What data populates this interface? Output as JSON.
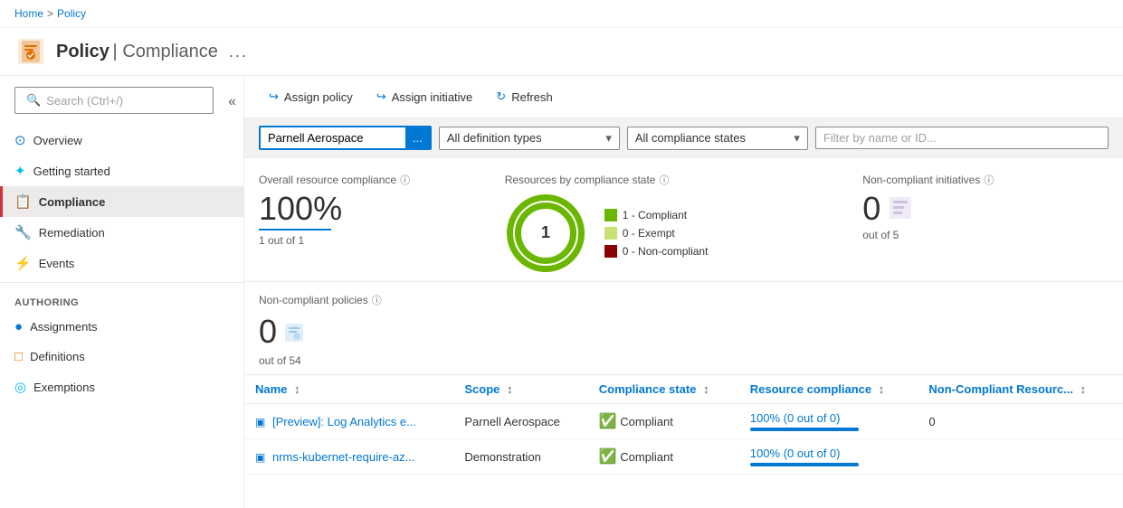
{
  "breadcrumb": {
    "home": "Home",
    "separator": ">",
    "current": "Policy"
  },
  "header": {
    "title": "Policy",
    "subtitle": "Compliance",
    "ellipsis": "..."
  },
  "sidebar": {
    "search_placeholder": "Search (Ctrl+/)",
    "items": [
      {
        "id": "overview",
        "label": "Overview",
        "icon": "○"
      },
      {
        "id": "getting-started",
        "label": "Getting started",
        "icon": "⚡"
      },
      {
        "id": "compliance",
        "label": "Compliance",
        "icon": "📋",
        "active": true
      }
    ],
    "remediation": {
      "label": "Remediation",
      "icon": "🔧"
    },
    "events": {
      "label": "Events",
      "icon": "⚡"
    },
    "authoring_label": "Authoring",
    "authoring_items": [
      {
        "id": "assignments",
        "label": "Assignments",
        "icon": "●"
      },
      {
        "id": "definitions",
        "label": "Definitions",
        "icon": "□"
      },
      {
        "id": "exemptions",
        "label": "Exemptions",
        "icon": "◎"
      }
    ]
  },
  "toolbar": {
    "assign_policy": "Assign policy",
    "assign_initiative": "Assign initiative",
    "refresh": "Refresh"
  },
  "filters": {
    "scope_value": "Parnell Aerospace",
    "scope_ellipsis": "...",
    "definition_types_label": "All definition types",
    "compliance_states_label": "All compliance states",
    "filter_placeholder": "Filter by name or ID..."
  },
  "metrics": {
    "overall_title": "Overall resource compliance",
    "overall_value": "100%",
    "overall_sub": "1 out of 1",
    "donut_title": "Resources by compliance state",
    "donut_center": "1",
    "legend": [
      {
        "label": "1 - Compliant",
        "color": "#6bb700"
      },
      {
        "label": "0 - Exempt",
        "color": "#c8e374"
      },
      {
        "label": "0 - Non-compliant",
        "color": "#8b0000"
      }
    ],
    "non_compliant_initiatives_title": "Non-compliant initiatives",
    "non_compliant_initiatives_value": "0",
    "non_compliant_initiatives_sub": "out of 5",
    "non_compliant_policies_title": "Non-compliant policies",
    "non_compliant_policies_value": "0",
    "non_compliant_policies_sub": "out of 54"
  },
  "table": {
    "columns": [
      {
        "id": "name",
        "label": "Name"
      },
      {
        "id": "scope",
        "label": "Scope"
      },
      {
        "id": "compliance_state",
        "label": "Compliance state"
      },
      {
        "id": "resource_compliance",
        "label": "Resource compliance"
      },
      {
        "id": "non_compliant_resources",
        "label": "Non-Compliant Resourc..."
      }
    ],
    "rows": [
      {
        "name": "[Preview]: Log Analytics e...",
        "scope": "Parnell Aerospace",
        "compliance_state": "Compliant",
        "resource_compliance_text": "100% (0 out of 0)",
        "resource_compliance_pct": 100,
        "non_compliant": "0"
      },
      {
        "name": "nrms-kubernet-require-az...",
        "scope": "Demonstration",
        "compliance_state": "Compliant",
        "resource_compliance_text": "100% (0 out of 0)",
        "resource_compliance_pct": 100,
        "non_compliant": ""
      }
    ]
  }
}
